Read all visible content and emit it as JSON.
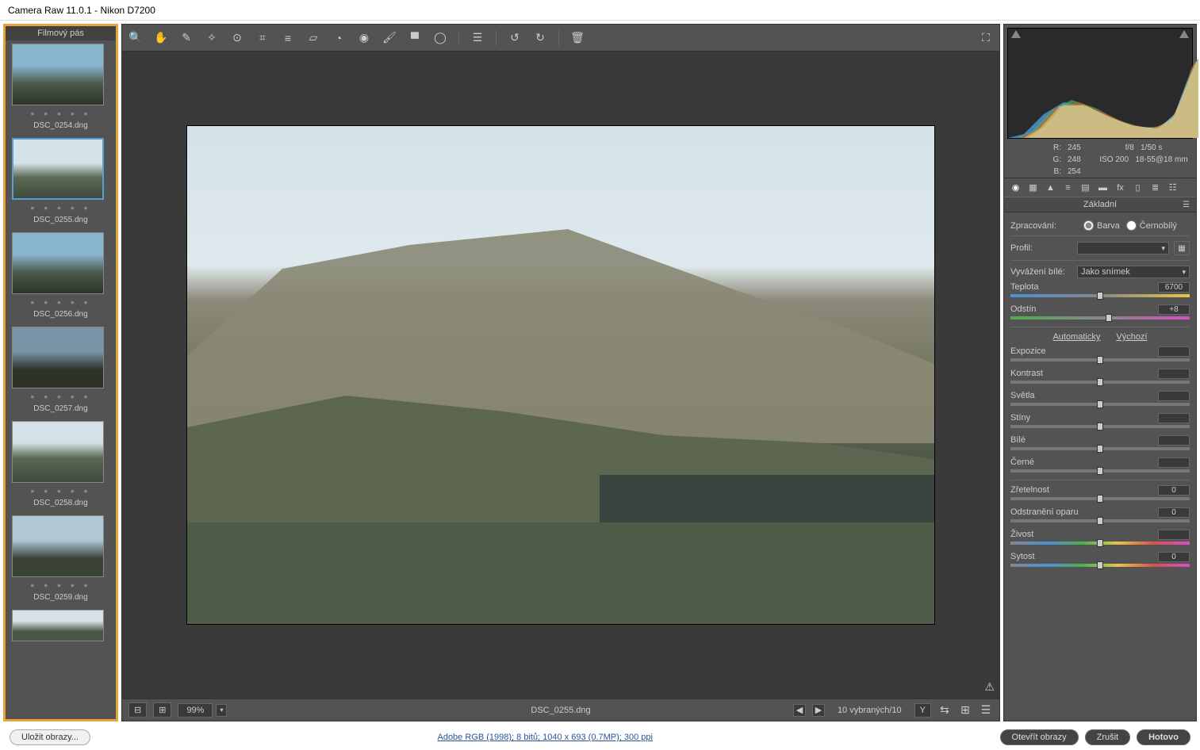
{
  "title": "Camera Raw 11.0.1  -  Nikon D7200",
  "filmstrip": {
    "header": "Filmový pás",
    "items": [
      {
        "name": "DSC_0254.dng"
      },
      {
        "name": "DSC_0255.dng"
      },
      {
        "name": "DSC_0256.dng"
      },
      {
        "name": "DSC_0257.dng"
      },
      {
        "name": "DSC_0258.dng"
      },
      {
        "name": "DSC_0259.dng"
      }
    ]
  },
  "status": {
    "zoom": "99%",
    "filename": "DSC_0255.dng",
    "selection": "10 vybraných/10",
    "yicon": "Y"
  },
  "info": {
    "r_label": "R:",
    "r": "245",
    "g_label": "G:",
    "g": "248",
    "b_label": "B:",
    "b": "254",
    "aperture": "f/8",
    "shutter": "1/50 s",
    "iso": "ISO 200",
    "lens": "18-55@18 mm"
  },
  "panel": {
    "title": "Základní",
    "processing_label": "Zpracování:",
    "color": "Barva",
    "bw": "Černobílý",
    "profile_label": "Profil:",
    "wb_label": "Vyvážení bílé:",
    "wb_value": "Jako snímek",
    "temp_label": "Teplota",
    "temp_value": "6700",
    "tint_label": "Odstín",
    "tint_value": "+8",
    "auto": "Automaticky",
    "default": "Výchozí",
    "exposure": "Expozice",
    "contrast": "Kontrast",
    "highlights": "Světla",
    "shadows": "Stíny",
    "whites": "Bílé",
    "blacks": "Černé",
    "clarity": "Zřetelnost",
    "clarity_v": "0",
    "dehaze": "Odstranění oparu",
    "dehaze_v": "0",
    "vibrance": "Živost",
    "saturation": "Sytost",
    "sat_v": "0"
  },
  "footer": {
    "save": "Uložit obrazy...",
    "workflow": "Adobe RGB (1998); 8 bitů; 1040 x 693 (0.7MP); 300 ppi",
    "open": "Otevřít obrazy",
    "cancel": "Zrušit",
    "done": "Hotovo"
  }
}
